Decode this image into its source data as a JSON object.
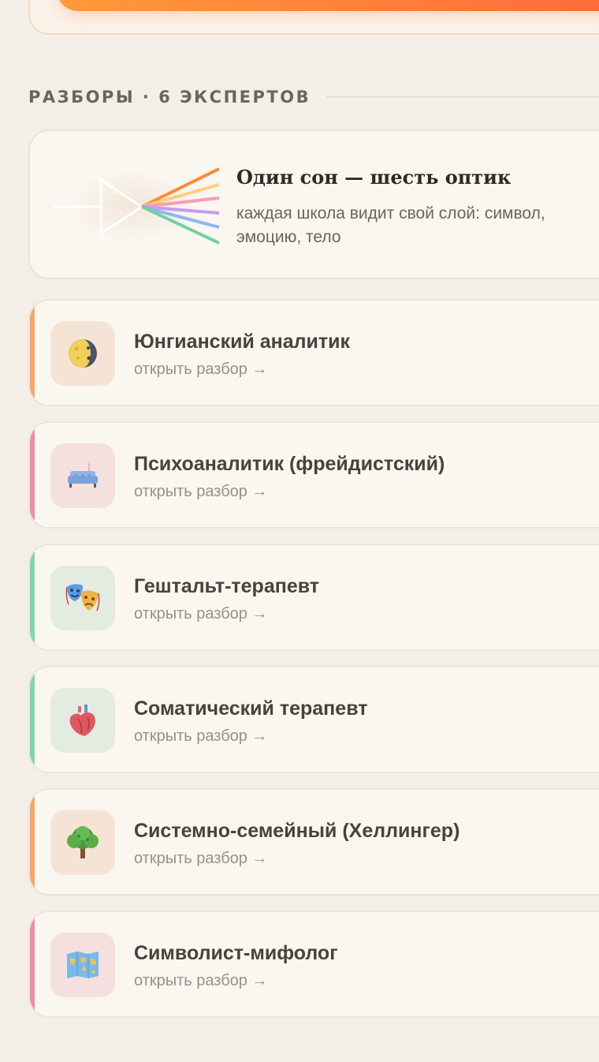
{
  "section": {
    "title": "РАЗБОРЫ · 6 ЭКСПЕРТОВ"
  },
  "intro": {
    "title": "Один сон — шесть оптик",
    "subtitle": "каждая школа видит свой слой: символ, эмоцию, тело"
  },
  "colors": {
    "accent_orange": "#f6a665",
    "accent_pink": "#f28aa8",
    "accent_mint": "#7fd6b0",
    "bg_orange": "#f5e4d6",
    "bg_pink": "#f5e0e0",
    "bg_mint": "#e4ece2"
  },
  "experts": [
    {
      "name": "Юнгианский аналитик",
      "link": "открыть разбор →",
      "icon": "moon-icon",
      "tone": "orange"
    },
    {
      "name": "Психоаналитик (фрейдистский)",
      "link": "открыть разбор →",
      "icon": "couch-icon",
      "tone": "pink"
    },
    {
      "name": "Гештальт-терапевт",
      "link": "открыть разбор →",
      "icon": "theater-masks-icon",
      "tone": "mint"
    },
    {
      "name": "Соматический терапевт",
      "link": "открыть разбор →",
      "icon": "anatomical-heart-icon",
      "tone": "mint"
    },
    {
      "name": "Системно-семейный (Хеллингер)",
      "link": "открыть разбор →",
      "icon": "tree-icon",
      "tone": "orange"
    },
    {
      "name": "Символист-мифолог",
      "link": "открыть разбор →",
      "icon": "world-map-icon",
      "tone": "pink"
    }
  ]
}
